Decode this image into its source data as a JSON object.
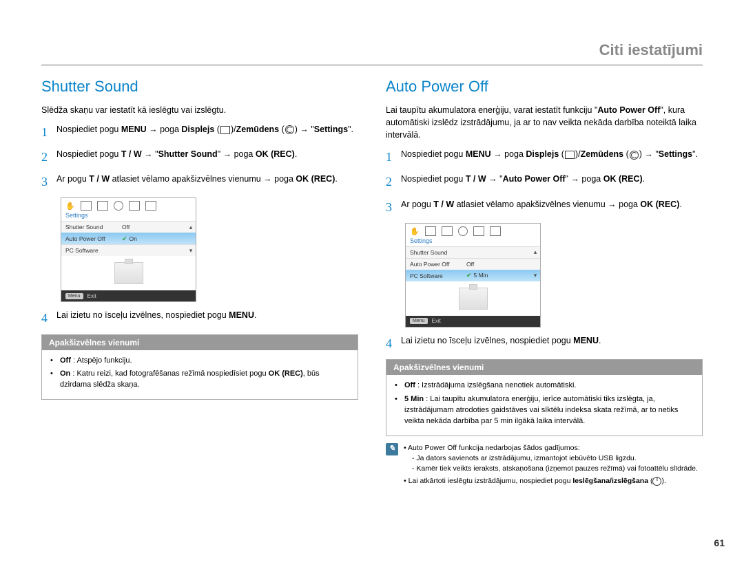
{
  "header": "Citi iestatījumi",
  "page_number": "61",
  "left": {
    "title": "Shutter Sound",
    "intro": "Slēdža skaņu var iestatīt kā ieslēgtu vai izslēgtu.",
    "step1_a": "Nospiediet pogu ",
    "step1_menu": "MENU",
    "step1_b": " → poga ",
    "step1_disp": "Displejs",
    "step1_c": " (",
    "step1_d": ")/",
    "step1_zem": "Zemūdens",
    "step1_e": " (",
    "step1_f": ") → \"",
    "step1_set": "Settings",
    "step1_g": "\".",
    "step2_a": "Nospiediet pogu ",
    "step2_tw": "T / W",
    "step2_b": " → \"",
    "step2_name": "Shutter Sound",
    "step2_c": "\" → poga ",
    "step2_ok": "OK (REC)",
    "step2_d": ".",
    "step3_a": "Ar pogu ",
    "step3_tw": "T / W",
    "step3_b": " atlasiet vēlamo apakšizvēlnes vienumu → poga ",
    "step3_ok": "OK (REC)",
    "step3_c": ".",
    "step4_a": "Lai izietu no īsceļu izvēlnes, nospiediet pogu ",
    "step4_menu": "MENU",
    "step4_b": ".",
    "menu_graphic": {
      "settings_label": "Settings",
      "rows": {
        "r0_label": "Shutter Sound",
        "r0_val": "Off",
        "r1_label": "Auto Power Off",
        "r1_val": "On",
        "r2_label": "PC Software",
        "r2_val": ""
      },
      "exit_badge": "Menu",
      "exit_label": "Exit"
    },
    "sub_title": "Apakšizvēlnes vienumi",
    "sub_off_lbl": "Off",
    "sub_off_txt": " : Atspējo funkciju.",
    "sub_on_lbl": "On",
    "sub_on_txt_a": " : Katru reizi, kad fotografēšanas režīmā nospiedīsiet pogu ",
    "sub_on_ok": "OK (REC)",
    "sub_on_txt_b": ", būs dzirdama slēdža skaņa."
  },
  "right": {
    "title": "Auto Power Off",
    "intro_a": "Lai taupītu akumulatora enerģiju, varat iestatīt funkciju \"",
    "intro_bold": "Auto Power Off",
    "intro_b": "\", kura automātiski izslēdz izstrādājumu, ja ar to nav veikta nekāda darbība noteiktā laika intervālā.",
    "step1_a": "Nospiediet pogu ",
    "step1_menu": "MENU",
    "step1_b": " → poga ",
    "step1_disp": "Displejs",
    "step1_c": " (",
    "step1_d": ")/",
    "step1_zem": "Zemūdens",
    "step1_e": " (",
    "step1_f": ") → \"",
    "step1_set": "Settings",
    "step1_g": "\".",
    "step2_a": "Nospiediet pogu ",
    "step2_tw": "T / W",
    "step2_b": " → \"",
    "step2_name": "Auto Power Off",
    "step2_c": "\" → poga ",
    "step2_ok": "OK (REC)",
    "step2_d": ".",
    "step3_a": "Ar pogu ",
    "step3_tw": "T / W",
    "step3_b": " atlasiet vēlamo apakšizvēlnes vienumu → poga ",
    "step3_ok": "OK (REC)",
    "step3_c": ".",
    "step4_a": "Lai izietu no īsceļu izvēlnes, nospiediet pogu ",
    "step4_menu": "MENU",
    "step4_b": ".",
    "menu_graphic": {
      "settings_label": "Settings",
      "rows": {
        "r0_label": "Shutter Sound",
        "r0_val": "",
        "r1_label": "Auto Power Off",
        "r1_val": "Off",
        "r2_label": "PC Software",
        "r2_val": "5 Min"
      },
      "exit_badge": "Menu",
      "exit_label": "Exit"
    },
    "sub_title": "Apakšizvēlnes vienumi",
    "sub_off_lbl": "Off",
    "sub_off_txt": " : Izstrādājuma izslēgšana nenotiek automātiski.",
    "sub_5_lbl": "5 Min",
    "sub_5_txt": " : Lai taupītu akumulatora enerģiju, ierīce automātiski tiks izslēgta, ja, izstrādājumam atrodoties gaidstāves vai sīktēlu indeksa skata režīmā, ar to netiks veikta nekāda darbība par 5 min ilgākā laika intervālā.",
    "note1": "Auto Power Off funkcija nedarbojas šādos gadījumos:",
    "note1_d1": "Ja dators savienots ar izstrādājumu, izmantojot iebūvēto USB ligzdu.",
    "note1_d2": "Kamēr tiek veikts ieraksts, atskaņošana (izņemot pauzes režīmā) vai fotoattēlu slīdrāde.",
    "note2_a": "Lai atkārtoti ieslēgtu izstrādājumu, nospiediet pogu ",
    "note2_bold": "Ieslēgšana/izslēgšana",
    "note2_b": " (",
    "note2_c": ")."
  }
}
